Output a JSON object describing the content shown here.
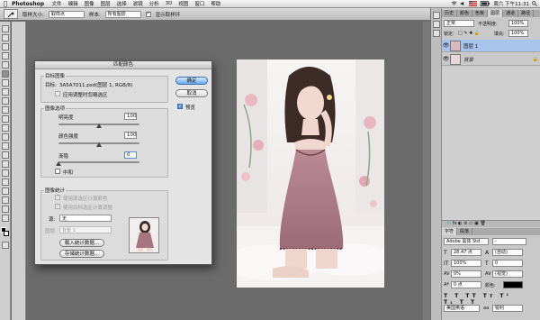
{
  "menubar": {
    "app_name": "Photoshop",
    "items": [
      "文件",
      "编辑",
      "图像",
      "图层",
      "选择",
      "滤镜",
      "分析",
      "3D",
      "视图",
      "窗口",
      "帮助"
    ],
    "clock": "周六 下午11:31"
  },
  "options_bar": {
    "sample_size_label": "取样大小:",
    "sample_size_value": "取样点",
    "sample_label": "样本:",
    "sample_value": "所有图层",
    "show_ring_label": "显示取样环"
  },
  "dialog": {
    "title": "匹配颜色",
    "target_group_label": "目标图像",
    "target_label": "目标:",
    "target_value": "3A5A7011.psd(图层 1, RGB/8)",
    "ignore_selection_label": "应用调整时忽略选区",
    "options_group_label": "图像选项",
    "luminance_label": "明亮度",
    "luminance_value": "100",
    "luminance": 100,
    "intensity_label": "颜色强度",
    "intensity_value": "100",
    "intensity": 100,
    "fade_label": "渐隐",
    "fade_value": "0",
    "fade": 0,
    "neutralize_label": "中和",
    "stats_group_label": "图像统计",
    "use_selection_source_label": "使用源选区计算颜色",
    "use_selection_target_label": "使用目标选区计算调整",
    "source_label": "源:",
    "source_value": "无",
    "layer_label": "图层:",
    "layer_value": "背景 1",
    "load_stats_label": "载入统计数据...",
    "save_stats_label": "存储统计数据...",
    "ok_label": "确定",
    "cancel_label": "取消",
    "preview_label": "预览"
  },
  "layers_panel": {
    "tabs": [
      "图层",
      "通道",
      "路径"
    ],
    "mode_value": "正常",
    "opacity_label": "不透明度:",
    "opacity_value": "100%",
    "lock_label": "锁定:",
    "fill_label": "填充:",
    "fill_value": "100%",
    "layers": [
      {
        "name": "图层 1",
        "selected": true
      },
      {
        "name": "背景",
        "selected": false
      }
    ]
  },
  "character_panel": {
    "tabs": [
      "字符",
      "段落"
    ],
    "font_family": "Adobe 黑体 Std",
    "font_style": "-",
    "font_size": "28.47 点",
    "leading": "(自动)",
    "tracking_v": "100%",
    "tracking_h": "0",
    "baseline_scale": "0%",
    "kerning": "(视觉)",
    "baseline_shift": "0 点",
    "color_label": "颜色:",
    "language": "美国英语",
    "antialias": "锐利"
  },
  "colors": {
    "accent": "#6aa8e8",
    "layer_selected": "#a9c4ec"
  }
}
